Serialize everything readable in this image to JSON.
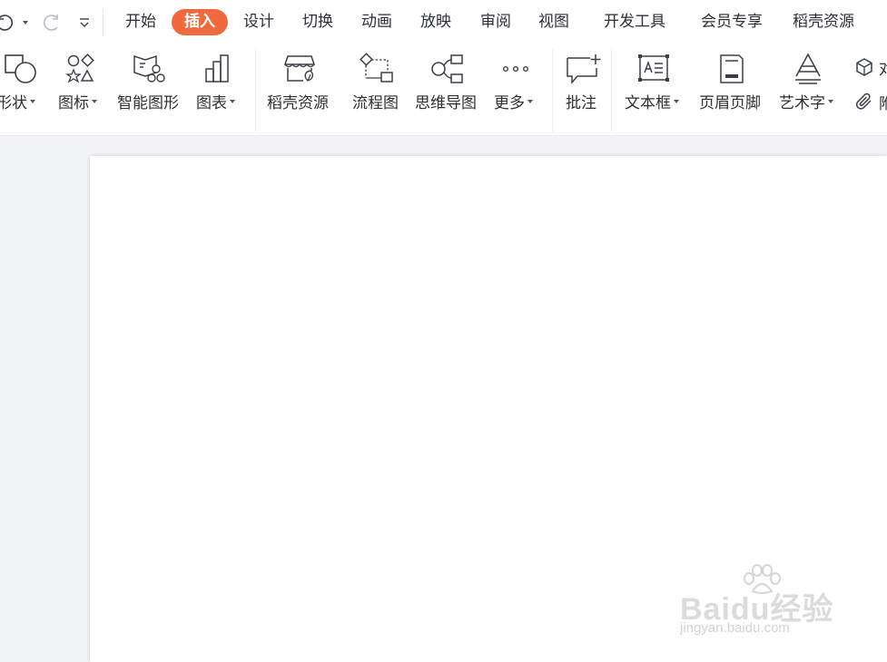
{
  "tabs": {
    "start": "开始",
    "insert": "插入",
    "design": "设计",
    "transition": "切换",
    "animation": "动画",
    "slideshow": "放映",
    "review": "审阅",
    "view": "视图",
    "developer": "开发工具",
    "member": "会员专享",
    "docer": "稻壳资源"
  },
  "ribbon": {
    "shape": "形状",
    "icon": "图标",
    "smartart": "智能图形",
    "chart": "图表",
    "docer_resource": "稻壳资源",
    "flowchart": "流程图",
    "mindmap": "思维导图",
    "more": "更多",
    "comment": "批注",
    "textbox": "文本框",
    "header_footer": "页眉页脚",
    "wordart": "艺术字",
    "object_partial": "对",
    "attachment_partial": "附"
  },
  "watermark": {
    "logo": "Baidu经验",
    "url": "jingyan.baidu.com"
  },
  "colors": {
    "accent": "#f06a3f",
    "icon_stroke": "#3a3f47",
    "canvas_bg": "#f3f4f6"
  }
}
